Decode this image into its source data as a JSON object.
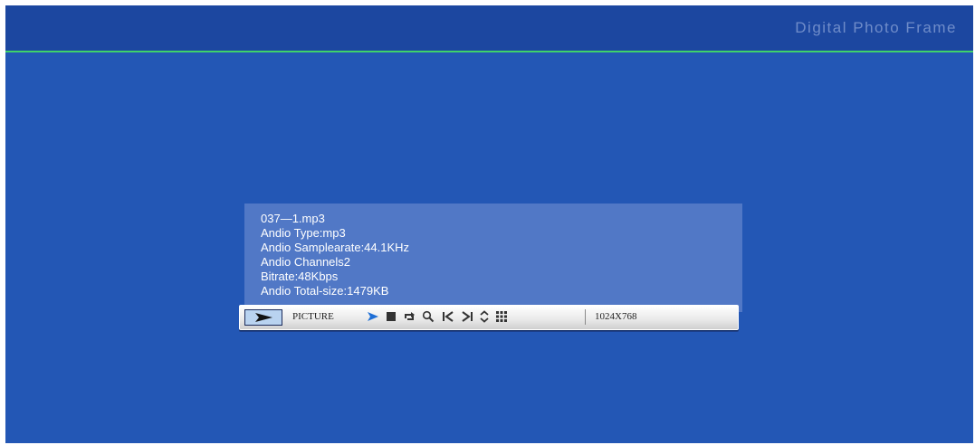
{
  "header": {
    "brand": "Digital Photo Frame"
  },
  "info": {
    "lines": [
      "037—1.mp3",
      "Andio Type:mp3",
      "Andio Samplearate:44.1KHz",
      "Andio Channels2",
      "Bitrate:48Kbps",
      "Andio Total-size:1479KB"
    ]
  },
  "controls": {
    "mode_label": "PICTURE",
    "resolution": "1024X768",
    "icons": [
      "mode-arrow-icon",
      "play-icon",
      "stop-icon",
      "repeat-icon",
      "zoom-icon",
      "previous-icon",
      "next-icon",
      "up-down-icon",
      "grid-icon"
    ]
  },
  "colors": {
    "background": "#2357b5",
    "header": "#1c47a0",
    "header_line": "#3fd36a",
    "panel": "#5178c6",
    "accent_icon": "#1f6fd6"
  }
}
